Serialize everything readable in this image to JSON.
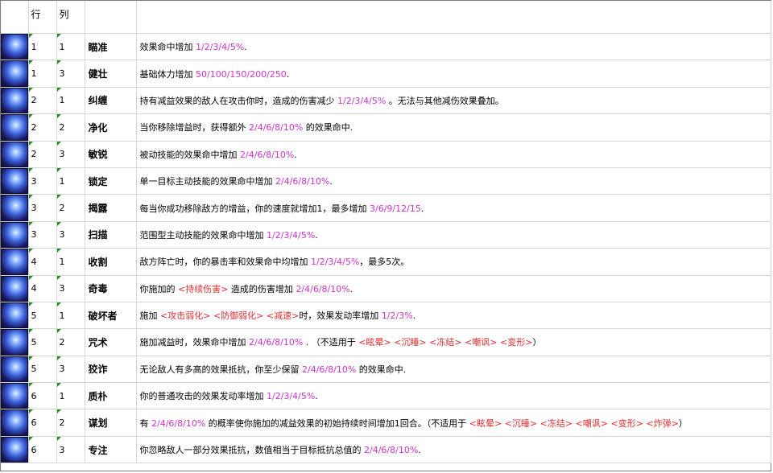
{
  "header": {
    "col_row": "行",
    "col_col": "列"
  },
  "rows": [
    {
      "row": "1",
      "col": "1",
      "name": "瞄准",
      "parts": [
        {
          "t": "效果命中增加 "
        },
        {
          "t": "1/2/3/4/5%",
          "c": "hl"
        },
        {
          "t": "."
        }
      ]
    },
    {
      "row": "1",
      "col": "3",
      "name": "健壮",
      "parts": [
        {
          "t": "基础体力增加 "
        },
        {
          "t": "50/100/150/200/250",
          "c": "hl"
        },
        {
          "t": "."
        }
      ]
    },
    {
      "row": "2",
      "col": "1",
      "name": "纠缠",
      "parts": [
        {
          "t": "持有减益效果的敌人在攻击你时，造成的伤害减少 "
        },
        {
          "t": "1/2/3/4/5%",
          "c": "hl"
        },
        {
          "t": " 。无法与其他减伤效果叠加。"
        }
      ]
    },
    {
      "row": "2",
      "col": "2",
      "name": "净化",
      "parts": [
        {
          "t": "当你移除增益时，获得额外 "
        },
        {
          "t": "2/4/6/8/10%",
          "c": "hl"
        },
        {
          "t": " 的效果命中."
        }
      ]
    },
    {
      "row": "2",
      "col": "3",
      "name": "敏锐",
      "parts": [
        {
          "t": "被动技能的效果命中增加 "
        },
        {
          "t": "2/4/6/8/10%",
          "c": "hl"
        },
        {
          "t": "."
        }
      ]
    },
    {
      "row": "3",
      "col": "1",
      "name": "锁定",
      "parts": [
        {
          "t": "单一目标主动技能的效果命中增加 "
        },
        {
          "t": "2/4/6/8/10%",
          "c": "hl"
        },
        {
          "t": "."
        }
      ]
    },
    {
      "row": "3",
      "col": "2",
      "name": "揭露",
      "parts": [
        {
          "t": "每当你成功移除敌方的增益，你的速度就增加1，最多增加 "
        },
        {
          "t": "3/6/9/12/15",
          "c": "hl"
        },
        {
          "t": "."
        }
      ]
    },
    {
      "row": "3",
      "col": "3",
      "name": "扫描",
      "parts": [
        {
          "t": "范围型主动技能的效果命中增加 "
        },
        {
          "t": "1/2/3/4/5%",
          "c": "hl"
        },
        {
          "t": "."
        }
      ]
    },
    {
      "row": "4",
      "col": "1",
      "name": "收割",
      "parts": [
        {
          "t": "敌方阵亡时，你的暴击率和效果命中均增加 "
        },
        {
          "t": "1/2/3/4/5%",
          "c": "hl"
        },
        {
          "t": "，最多5次。"
        }
      ]
    },
    {
      "row": "4",
      "col": "3",
      "name": "奇毒",
      "parts": [
        {
          "t": "你施加的 "
        },
        {
          "t": "<持续伤害>",
          "c": "st"
        },
        {
          "t": " 造成的伤害增加 "
        },
        {
          "t": "2/4/6/8/10%",
          "c": "hl"
        },
        {
          "t": "."
        }
      ]
    },
    {
      "row": "5",
      "col": "1",
      "name": "破坏者",
      "parts": [
        {
          "t": "施加 "
        },
        {
          "t": "<攻击弱化>",
          "c": "st"
        },
        {
          "t": " "
        },
        {
          "t": "<防御弱化>",
          "c": "st"
        },
        {
          "t": " "
        },
        {
          "t": "<减速>",
          "c": "st"
        },
        {
          "t": "时，效果发动率增加 "
        },
        {
          "t": "1/2/3%",
          "c": "hl"
        },
        {
          "t": "."
        }
      ]
    },
    {
      "row": "5",
      "col": "2",
      "name": "咒术",
      "parts": [
        {
          "t": "施加减益时，效果命中增加 "
        },
        {
          "t": "2/4/6/8/10%",
          "c": "hl"
        },
        {
          "t": " . （不适用于 "
        },
        {
          "t": "<眩晕>",
          "c": "st"
        },
        {
          "t": " "
        },
        {
          "t": "<沉睡>",
          "c": "st"
        },
        {
          "t": " "
        },
        {
          "t": "<冻结>",
          "c": "st"
        },
        {
          "t": " "
        },
        {
          "t": "<嘲讽>",
          "c": "st"
        },
        {
          "t": " "
        },
        {
          "t": "<变形>",
          "c": "st"
        },
        {
          "t": "）"
        }
      ]
    },
    {
      "row": "5",
      "col": "3",
      "name": "狡诈",
      "parts": [
        {
          "t": "无论敌人有多高的效果抵抗，你至少保留 "
        },
        {
          "t": "2/4/6/8/10%",
          "c": "hl"
        },
        {
          "t": " 的效果命中."
        }
      ]
    },
    {
      "row": "6",
      "col": "1",
      "name": "质朴",
      "parts": [
        {
          "t": "你的普通攻击的效果发动率增加 "
        },
        {
          "t": "1/2/3/4/5%",
          "c": "hl"
        },
        {
          "t": "."
        }
      ]
    },
    {
      "row": "6",
      "col": "2",
      "name": "谋划",
      "parts": [
        {
          "t": "有 "
        },
        {
          "t": "2/4/6/8/10%",
          "c": "hl"
        },
        {
          "t": " 的概率使你施加的减益效果的初始持续时间增加1回合。（不适用于 "
        },
        {
          "t": "<眩晕>",
          "c": "st"
        },
        {
          "t": " "
        },
        {
          "t": "<沉睡>",
          "c": "st"
        },
        {
          "t": " "
        },
        {
          "t": "<冻结>",
          "c": "st"
        },
        {
          "t": " "
        },
        {
          "t": "<嘲讽>",
          "c": "st"
        },
        {
          "t": " "
        },
        {
          "t": "<变形>",
          "c": "st"
        },
        {
          "t": " "
        },
        {
          "t": "<炸弹>",
          "c": "st"
        },
        {
          "t": "）"
        }
      ]
    },
    {
      "row": "6",
      "col": "3",
      "name": "专注",
      "parts": [
        {
          "t": "你忽略敌人一部分效果抵抗，数值相当于目标抵抗总值的 "
        },
        {
          "t": "2/4/6/8/10%",
          "c": "hl"
        },
        {
          "t": "."
        }
      ]
    }
  ]
}
